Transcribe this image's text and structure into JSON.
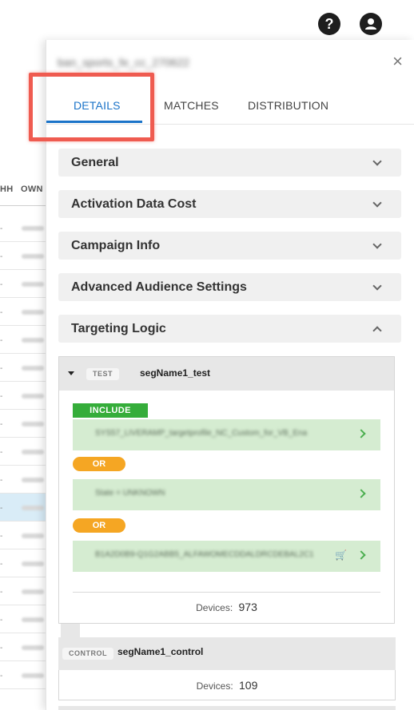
{
  "header": {
    "help_icon": "help-icon",
    "user_icon": "user-icon"
  },
  "background_table": {
    "headers": [
      "HH",
      "OWN"
    ],
    "selected_row": 10
  },
  "panel": {
    "title": "ban_sports_fe_cc_270622",
    "close_label": "×",
    "tabs": [
      {
        "label": "DETAILS",
        "active": true
      },
      {
        "label": "MATCHES",
        "active": false
      },
      {
        "label": "DISTRIBUTION",
        "active": false
      }
    ],
    "sections": [
      {
        "label": "General",
        "expanded": false
      },
      {
        "label": "Activation Data Cost",
        "expanded": false
      },
      {
        "label": "Campaign Info",
        "expanded": false
      },
      {
        "label": "Advanced Audience Settings",
        "expanded": false
      },
      {
        "label": "Targeting Logic",
        "expanded": true
      }
    ],
    "test_segment": {
      "tag": "TEST",
      "name": "segName1_test",
      "include_label": "INCLUDE",
      "or_label": "OR",
      "rules": [
        "SYS57_LIVERAMP_targetprofile_NC_Custom_for_VB_Ena",
        "State = UNKNOWN",
        "B1A2D0B9-Q1G2ABB5_ALFAWOMECDDALDRCDEBAL2C1"
      ],
      "devices_label": "Devices:",
      "devices_value": "973"
    },
    "control_segment": {
      "tag": "CONTROL",
      "name": "segName1_control",
      "devices_label": "Devices:",
      "devices_value": "109"
    }
  },
  "colors": {
    "accent": "#1a73c8",
    "include": "#35ad3a",
    "or": "#f5a623",
    "rule_bg": "#d5ecd1",
    "highlight": "#ef5b50"
  }
}
